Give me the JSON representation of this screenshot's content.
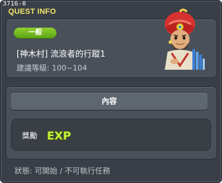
{
  "window": {
    "quest_id": "3716-0",
    "title": "QUEST INFO"
  },
  "summary": {
    "badge": "一般",
    "quest_name": "[神木村] 流浪者的行蹤1",
    "level_label": "建議等級: 100~104"
  },
  "content": {
    "tab_label": "內容",
    "reward_label": "獎勵",
    "reward_icon_text": "EXP"
  },
  "status": {
    "text": "狀態: 可開始 / 不可執行任務"
  },
  "colors": {
    "title": "#f2e86b",
    "badge": "#6db51a",
    "exp": "#c7f23a"
  }
}
